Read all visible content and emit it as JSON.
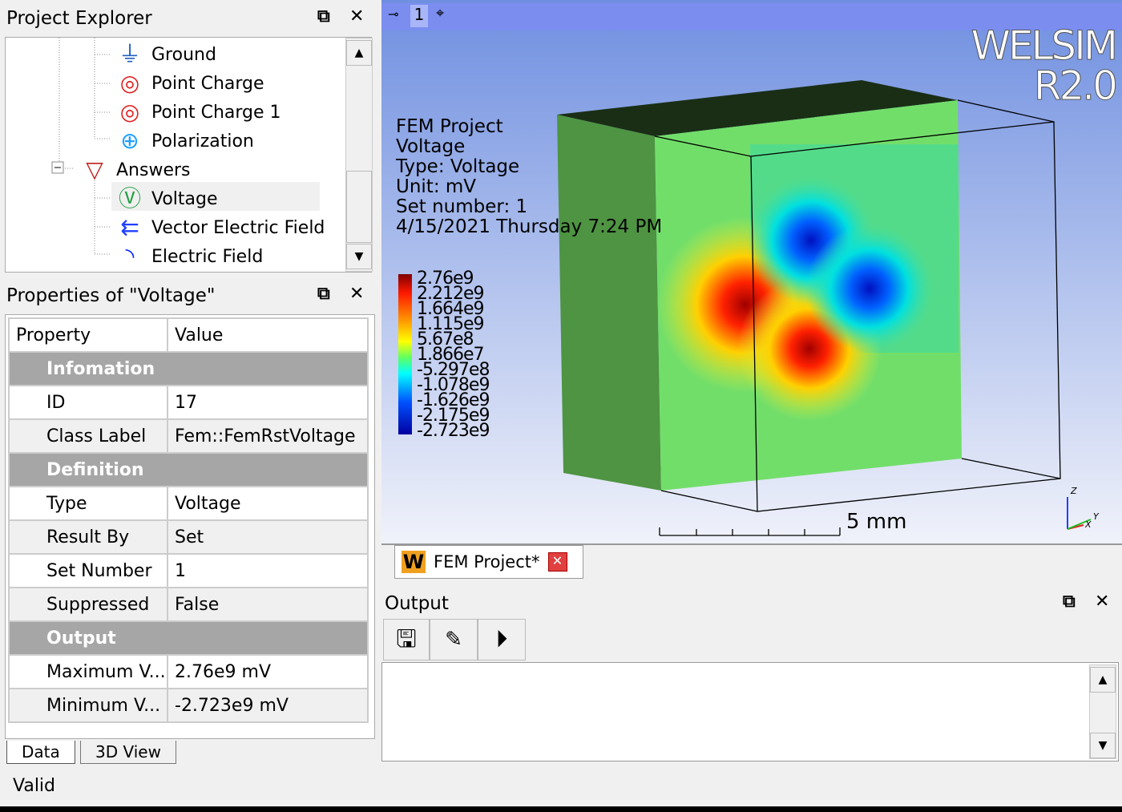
{
  "explorer": {
    "title": "Project Explorer",
    "items": [
      {
        "label": "Ground",
        "icon": "ground-icon"
      },
      {
        "label": "Point Charge",
        "icon": "point-charge-icon"
      },
      {
        "label": "Point Charge 1",
        "icon": "point-charge-icon"
      },
      {
        "label": "Polarization",
        "icon": "polarization-icon"
      },
      {
        "label": "Answers",
        "icon": "answers-icon"
      },
      {
        "label": "Voltage",
        "icon": "voltage-icon",
        "selected": true
      },
      {
        "label": "Vector Electric Field",
        "icon": "vector-field-icon"
      },
      {
        "label": "Electric Field",
        "icon": "electric-field-icon"
      }
    ]
  },
  "properties": {
    "title": "Properties of \"Voltage\"",
    "header": [
      "Property",
      "Value"
    ],
    "groups": [
      {
        "name": "Infomation",
        "rows": [
          [
            "ID",
            "17"
          ],
          [
            "Class Label",
            "Fem::FemRstVoltage"
          ]
        ]
      },
      {
        "name": "Definition",
        "rows": [
          [
            "Type",
            "Voltage"
          ],
          [
            "Result By",
            "Set"
          ],
          [
            "Set Number",
            "1"
          ],
          [
            "Suppressed",
            "False"
          ]
        ]
      },
      {
        "name": "Output",
        "rows": [
          [
            "Maximum V...",
            "2.76e9 mV"
          ],
          [
            "Minimum V...",
            "-2.723e9 mV"
          ]
        ]
      }
    ]
  },
  "bottom_tabs": [
    "Data",
    "3D View"
  ],
  "status": "Valid",
  "viewport": {
    "tab_number": "1",
    "brand": [
      "WELSIM",
      "R2.0"
    ],
    "info": [
      "FEM Project",
      "Voltage",
      "Type: Voltage",
      "Unit: mV",
      "Set number: 1",
      "4/15/2021 Thursday 7:24 PM"
    ],
    "legend": [
      "2.76e9",
      "2.212e9",
      "1.664e9",
      "1.115e9",
      "5.67e8",
      "1.866e7",
      "-5.297e8",
      "-1.078e9",
      "-1.626e9",
      "-2.175e9",
      "-2.723e9"
    ],
    "scale_label": "5 mm",
    "axes": [
      "Z",
      "Y",
      "X"
    ]
  },
  "doc_tab": {
    "label": "FEM Project*",
    "logo": "W"
  },
  "output": {
    "title": "Output",
    "buttons": [
      "save-icon",
      "clear-icon",
      "run-icon"
    ]
  },
  "colors": {
    "viewport_top": "#6f8fe0",
    "viewport_bottom": "#f0f2fa",
    "selected": "#f0f0f0",
    "group": "#a6a6a6"
  }
}
